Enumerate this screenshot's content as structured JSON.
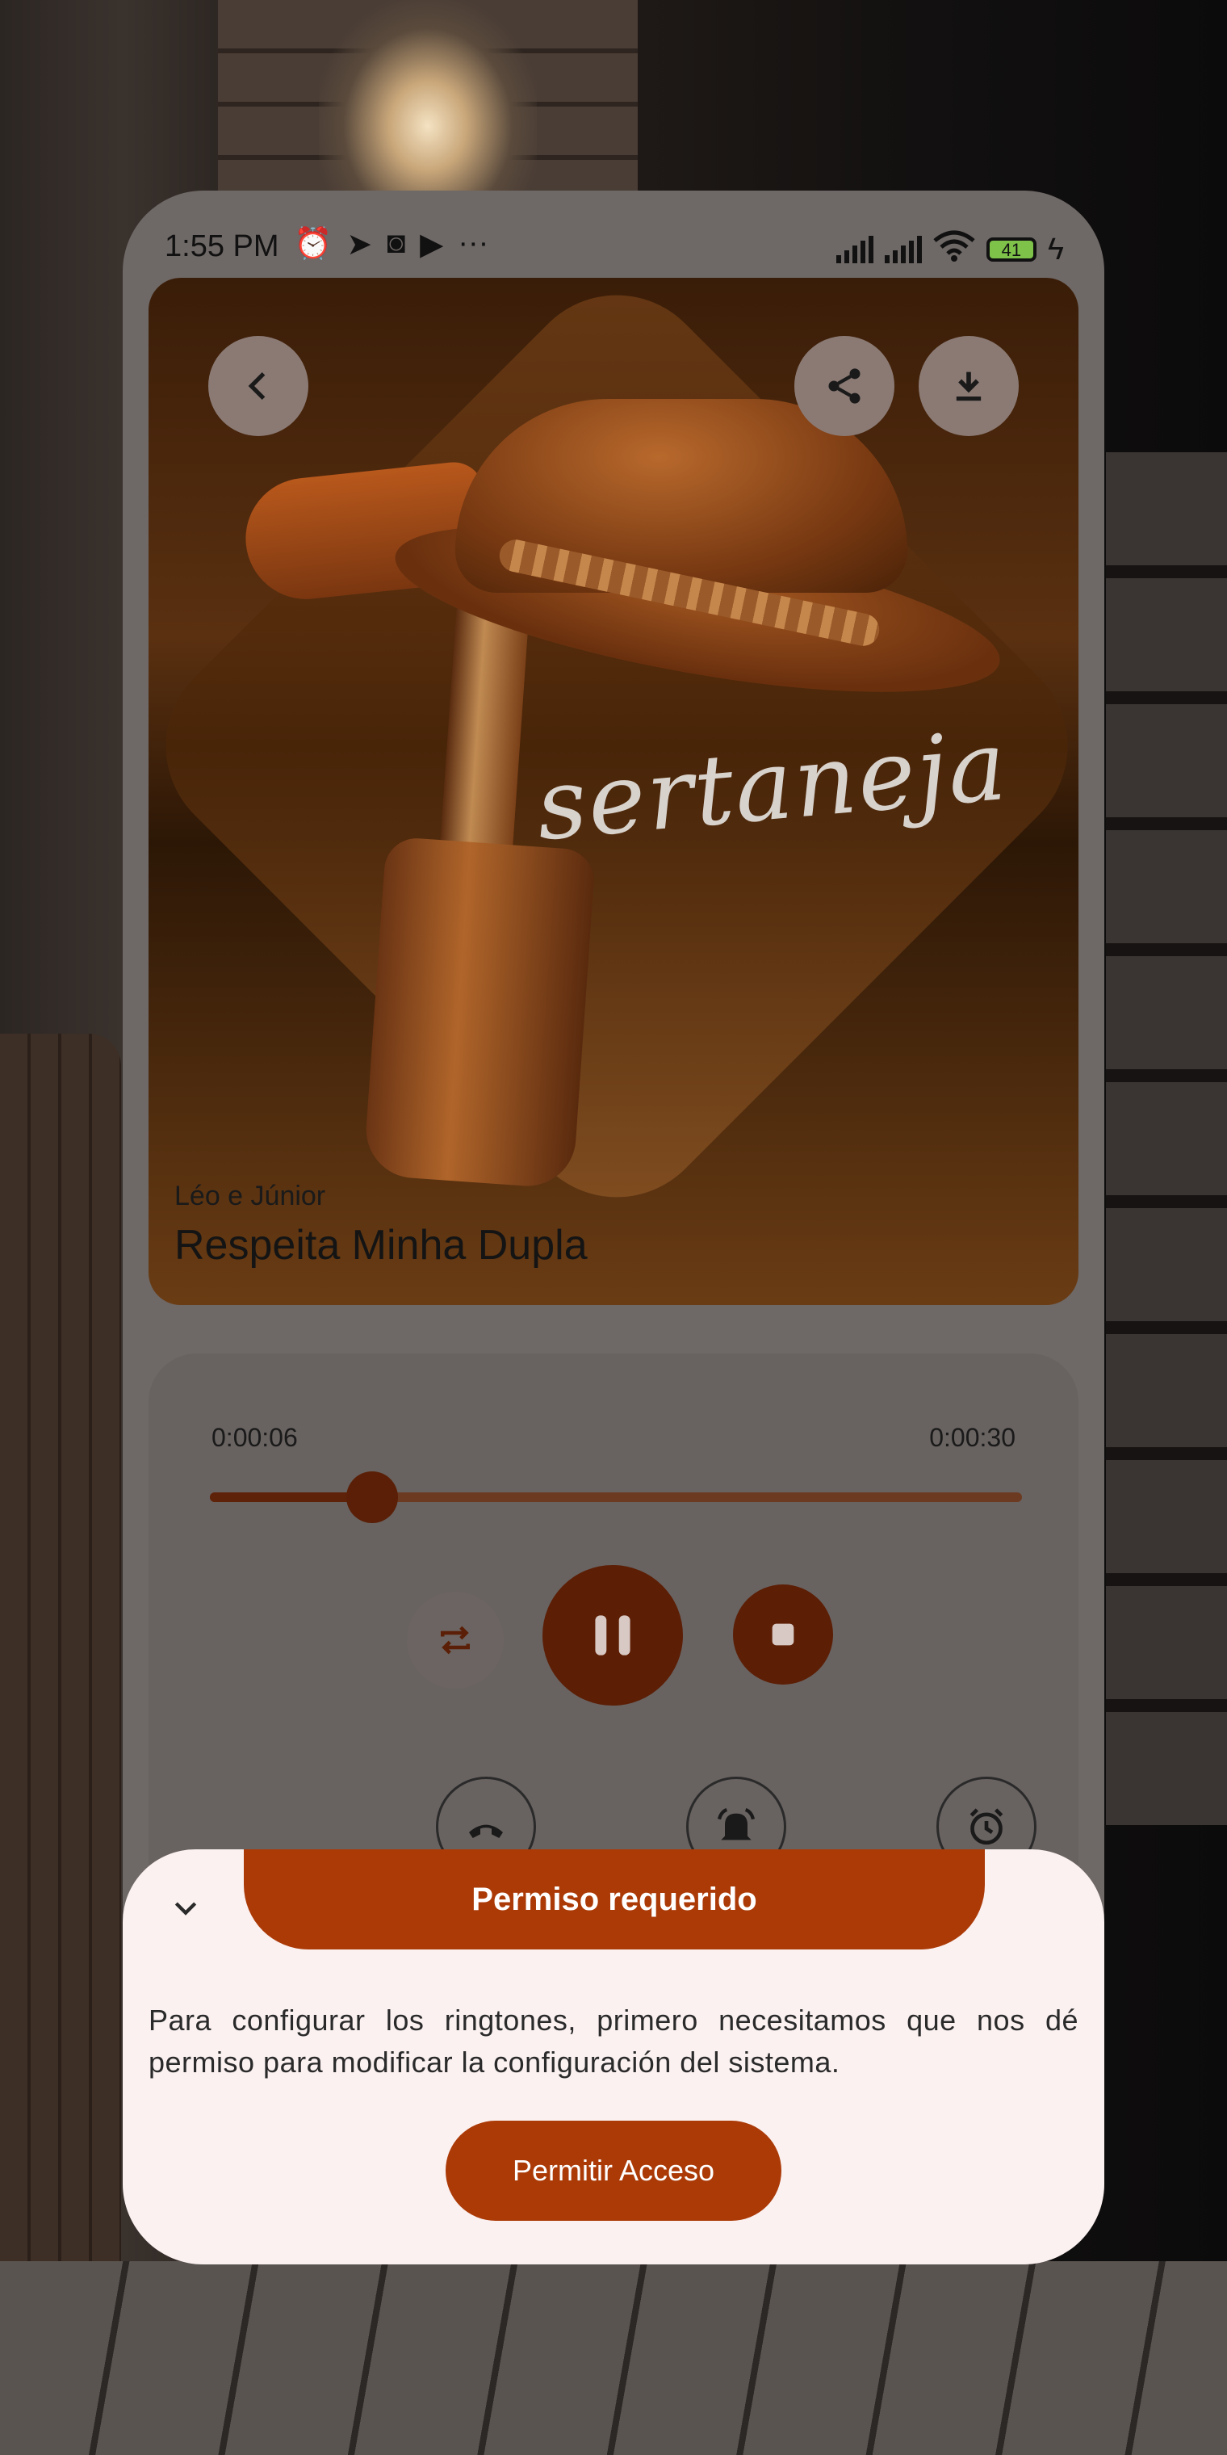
{
  "status_bar": {
    "time": "1:55 PM",
    "left_icons": [
      "alarm-icon",
      "telegram-icon",
      "instagram-icon",
      "play-store-icon",
      "more-icon"
    ],
    "right_icons": [
      "signal-icon",
      "signal-icon",
      "wifi-icon",
      "battery-icon",
      "charging-icon"
    ],
    "battery_level": "41"
  },
  "track": {
    "artwork_text": "sertaneja",
    "artist": "Léo e Júnior",
    "title": "Respeita Minha Dupla"
  },
  "player": {
    "elapsed": "0:00:06",
    "duration": "0:00:30",
    "progress": 0.2
  },
  "dialog": {
    "title": "Permiso requerido",
    "message": "Para configurar los ringtones, primero necesitamos que nos dé permiso para modificar la configuración del sistema.",
    "action": "Permitir Acceso"
  },
  "colors": {
    "accent": "#ab3a07",
    "sheet_background": "#fbf1f1",
    "scrim": "#6e6866"
  }
}
